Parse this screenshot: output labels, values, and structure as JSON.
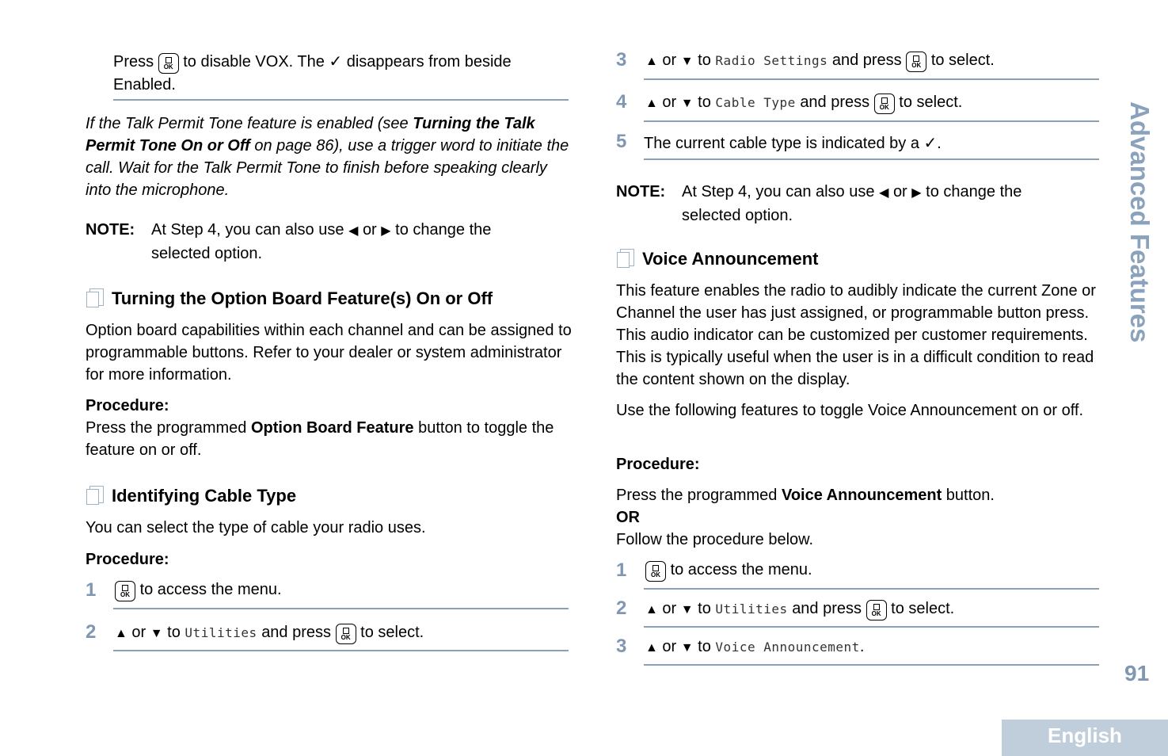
{
  "left": {
    "vox_step": {
      "pre": "Press",
      "mid": "to disable VOX. The ✓ disappears from beside",
      "line2": "Enabled."
    },
    "talk_permit_note": {
      "pre": "If the Talk Permit Tone feature is enabled (see ",
      "bold": "Turning the Talk Permit Tone On or Off",
      "post": " on page 86), use a trigger word to initiate the call. Wait for the Talk Permit Tone to finish before speaking clearly into the microphone."
    },
    "note1": {
      "label": "NOTE:",
      "line1_a": "At Step 4, you can also use",
      "or": "or",
      "line1_b": "to change the",
      "line2": "selected option."
    },
    "option_board": {
      "heading": "Turning the Option Board Feature(s) On or Off",
      "body": "Option board capabilities within each channel and can be assigned to programmable buttons. Refer to your dealer or system administrator for more information.",
      "procedure_label": "Procedure:",
      "proc_pre": "Press the programmed ",
      "proc_bold": "Option Board Feature",
      "proc_post": " button to toggle the feature on or off."
    },
    "cable_type": {
      "heading": "Identifying Cable Type",
      "body": "You can select the type of cable your radio uses.",
      "procedure_label": "Procedure:",
      "steps": [
        {
          "num": "1",
          "text": "to access the menu."
        },
        {
          "num": "2",
          "or": "or",
          "to": "to",
          "menu": "Utilities",
          "and_press": "and press",
          "post": "to select."
        }
      ]
    }
  },
  "right": {
    "steps": [
      {
        "num": "3",
        "or": "or",
        "to": "to",
        "menu": "Radio Settings",
        "and_press": "and press",
        "post": "to select."
      },
      {
        "num": "4",
        "or": "or",
        "to": "to",
        "menu": "Cable Type",
        "and_press": "and press",
        "post": "to select."
      },
      {
        "num": "5",
        "text": "The current cable type is indicated by a ✓."
      }
    ],
    "note": {
      "label": "NOTE:",
      "line1_a": "At Step 4, you can also use",
      "or": "or",
      "line1_b": "to change the",
      "line2": "selected option."
    },
    "voice": {
      "heading": "Voice Announcement",
      "body1": "This feature enables the radio to audibly indicate the current Zone or Channel the user has just assigned, or programmable button press. This audio indicator can be customized per customer requirements. This is typically useful when the user is in a difficult condition to read the content shown on the display.",
      "body2": "Use the following features to toggle Voice Announcement on or off.",
      "procedure_label": "Procedure:",
      "proc_pre": "Press the programmed ",
      "proc_bold": "Voice Announcement",
      "proc_post": " button.",
      "or_label": "OR",
      "follow": "Follow the procedure below.",
      "steps": [
        {
          "num": "1",
          "text": "to access the menu."
        },
        {
          "num": "2",
          "or": "or",
          "to": "to",
          "menu": "Utilities",
          "and_press": "and press",
          "post": "to select."
        },
        {
          "num": "3",
          "or": "or",
          "to": "to",
          "menu": "Voice Announcement",
          "post": "."
        }
      ]
    }
  },
  "side_tab": "Advanced Features",
  "page_number": "91",
  "language_tab": "English",
  "colors": {
    "accent": "#7f97b2",
    "rule": "#8aa0b6",
    "language_tab_bg": "#c0cedb"
  }
}
